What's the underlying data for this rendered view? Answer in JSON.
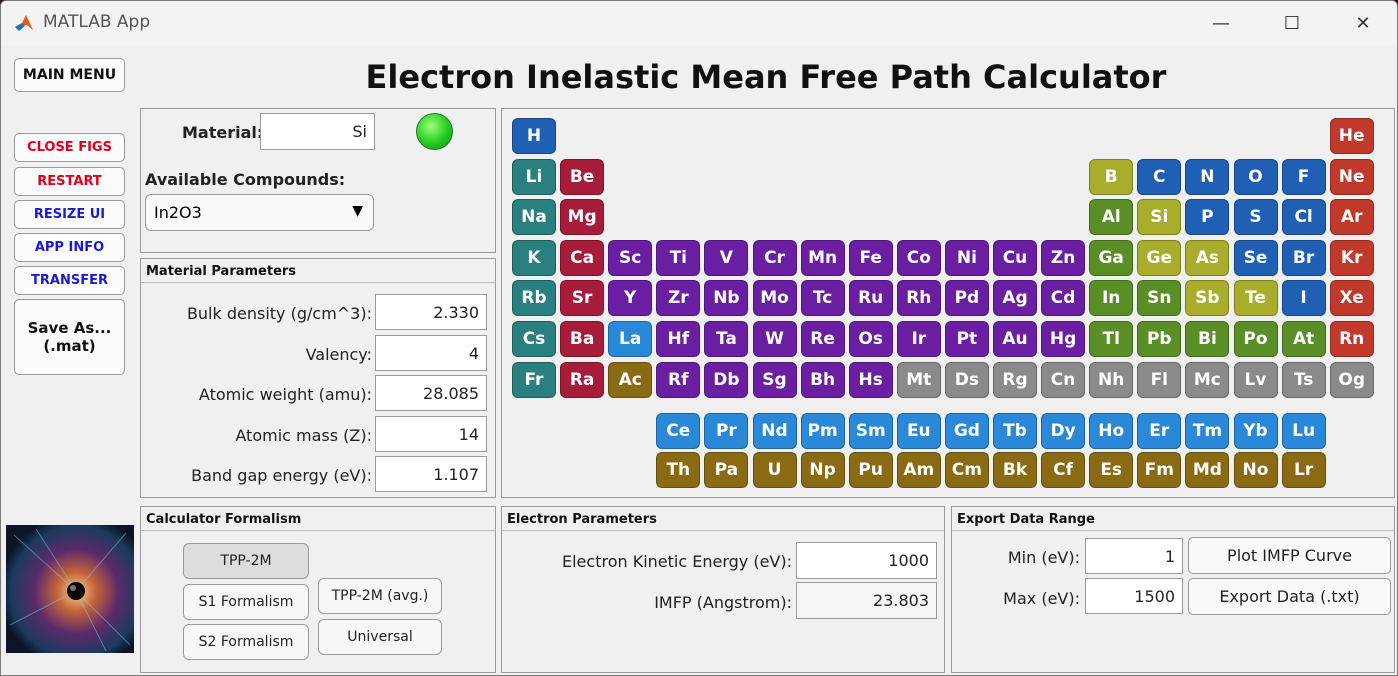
{
  "window": {
    "title": "MATLAB App"
  },
  "main_title": "Electron Inelastic Mean Free Path Calculator",
  "sidebar": {
    "main_menu": "MAIN MENU",
    "close_figs": "CLOSE FIGS",
    "restart": "RESTART",
    "resize_ui": "RESIZE UI",
    "app_info": "APP INFO",
    "transfer": "TRANSFER",
    "save_as_line1": "Save As...",
    "save_as_line2": "(.mat)"
  },
  "material": {
    "label": "Material:",
    "value": "Si",
    "status_color": "#22cc22",
    "compounds_label": "Available Compounds:",
    "compound_selected": "In2O3"
  },
  "material_params": {
    "heading": "Material Parameters",
    "rows": [
      {
        "label": "Bulk density (g/cm^3):",
        "value": "2.330"
      },
      {
        "label": "Valency:",
        "value": "4"
      },
      {
        "label": "Atomic weight (amu):",
        "value": "28.085"
      },
      {
        "label": "Atomic mass (Z):",
        "value": "14"
      },
      {
        "label": "Band gap energy (eV):",
        "value": "1.107"
      }
    ]
  },
  "calculator": {
    "heading": "Calculator Formalism",
    "tpp2m": "TPP-2M",
    "s1": "S1 Formalism",
    "s2": "S2 Formalism",
    "tpp2m_avg": "TPP-2M (avg.)",
    "universal": "Universal"
  },
  "electron_params": {
    "heading": "Electron Parameters",
    "ke_label": "Electron Kinetic Energy (eV):",
    "ke_value": "1000",
    "imfp_label": "IMFP (Angstrom):",
    "imfp_value": "23.803"
  },
  "export": {
    "heading": "Export Data Range",
    "min_label": "Min (eV):",
    "min_value": "1",
    "max_label": "Max (eV):",
    "max_value": "1500",
    "plot_btn": "Plot IMFP Curve",
    "export_btn": "Export Data (.txt)"
  },
  "colors": {
    "nonmetal": "#1f5fb4",
    "alkali": "#2a7f7f",
    "alkaline": "#a61c3a",
    "transition": "#6a1fa3",
    "post_transition": "#5a8f28",
    "metalloid": "#a9ad2c",
    "noble": "#c0392b",
    "unknown": "#8a8a8a",
    "lanthanide": "#2a88d8",
    "actinide": "#8a6a12"
  },
  "elements": [
    {
      "sym": "H",
      "c": "nonmetal",
      "r": 0,
      "col": 0
    },
    {
      "sym": "He",
      "c": "noble",
      "r": 0,
      "col": 17
    },
    {
      "sym": "Li",
      "c": "alkali",
      "r": 1,
      "col": 0
    },
    {
      "sym": "Be",
      "c": "alkaline",
      "r": 1,
      "col": 1
    },
    {
      "sym": "B",
      "c": "metalloid",
      "r": 1,
      "col": 12
    },
    {
      "sym": "C",
      "c": "nonmetal",
      "r": 1,
      "col": 13
    },
    {
      "sym": "N",
      "c": "nonmetal",
      "r": 1,
      "col": 14
    },
    {
      "sym": "O",
      "c": "nonmetal",
      "r": 1,
      "col": 15
    },
    {
      "sym": "F",
      "c": "nonmetal",
      "r": 1,
      "col": 16
    },
    {
      "sym": "Ne",
      "c": "noble",
      "r": 1,
      "col": 17
    },
    {
      "sym": "Na",
      "c": "alkali",
      "r": 2,
      "col": 0
    },
    {
      "sym": "Mg",
      "c": "alkaline",
      "r": 2,
      "col": 1
    },
    {
      "sym": "Al",
      "c": "post_transition",
      "r": 2,
      "col": 12
    },
    {
      "sym": "Si",
      "c": "metalloid",
      "r": 2,
      "col": 13
    },
    {
      "sym": "P",
      "c": "nonmetal",
      "r": 2,
      "col": 14
    },
    {
      "sym": "S",
      "c": "nonmetal",
      "r": 2,
      "col": 15
    },
    {
      "sym": "Cl",
      "c": "nonmetal",
      "r": 2,
      "col": 16
    },
    {
      "sym": "Ar",
      "c": "noble",
      "r": 2,
      "col": 17
    },
    {
      "sym": "K",
      "c": "alkali",
      "r": 3,
      "col": 0
    },
    {
      "sym": "Ca",
      "c": "alkaline",
      "r": 3,
      "col": 1
    },
    {
      "sym": "Sc",
      "c": "transition",
      "r": 3,
      "col": 2
    },
    {
      "sym": "Ti",
      "c": "transition",
      "r": 3,
      "col": 3
    },
    {
      "sym": "V",
      "c": "transition",
      "r": 3,
      "col": 4
    },
    {
      "sym": "Cr",
      "c": "transition",
      "r": 3,
      "col": 5
    },
    {
      "sym": "Mn",
      "c": "transition",
      "r": 3,
      "col": 6
    },
    {
      "sym": "Fe",
      "c": "transition",
      "r": 3,
      "col": 7
    },
    {
      "sym": "Co",
      "c": "transition",
      "r": 3,
      "col": 8
    },
    {
      "sym": "Ni",
      "c": "transition",
      "r": 3,
      "col": 9
    },
    {
      "sym": "Cu",
      "c": "transition",
      "r": 3,
      "col": 10
    },
    {
      "sym": "Zn",
      "c": "transition",
      "r": 3,
      "col": 11
    },
    {
      "sym": "Ga",
      "c": "post_transition",
      "r": 3,
      "col": 12
    },
    {
      "sym": "Ge",
      "c": "metalloid",
      "r": 3,
      "col": 13
    },
    {
      "sym": "As",
      "c": "metalloid",
      "r": 3,
      "col": 14
    },
    {
      "sym": "Se",
      "c": "nonmetal",
      "r": 3,
      "col": 15
    },
    {
      "sym": "Br",
      "c": "nonmetal",
      "r": 3,
      "col": 16
    },
    {
      "sym": "Kr",
      "c": "noble",
      "r": 3,
      "col": 17
    },
    {
      "sym": "Rb",
      "c": "alkali",
      "r": 4,
      "col": 0
    },
    {
      "sym": "Sr",
      "c": "alkaline",
      "r": 4,
      "col": 1
    },
    {
      "sym": "Y",
      "c": "transition",
      "r": 4,
      "col": 2
    },
    {
      "sym": "Zr",
      "c": "transition",
      "r": 4,
      "col": 3
    },
    {
      "sym": "Nb",
      "c": "transition",
      "r": 4,
      "col": 4
    },
    {
      "sym": "Mo",
      "c": "transition",
      "r": 4,
      "col": 5
    },
    {
      "sym": "Tc",
      "c": "transition",
      "r": 4,
      "col": 6
    },
    {
      "sym": "Ru",
      "c": "transition",
      "r": 4,
      "col": 7
    },
    {
      "sym": "Rh",
      "c": "transition",
      "r": 4,
      "col": 8
    },
    {
      "sym": "Pd",
      "c": "transition",
      "r": 4,
      "col": 9
    },
    {
      "sym": "Ag",
      "c": "transition",
      "r": 4,
      "col": 10
    },
    {
      "sym": "Cd",
      "c": "transition",
      "r": 4,
      "col": 11
    },
    {
      "sym": "In",
      "c": "post_transition",
      "r": 4,
      "col": 12
    },
    {
      "sym": "Sn",
      "c": "post_transition",
      "r": 4,
      "col": 13
    },
    {
      "sym": "Sb",
      "c": "metalloid",
      "r": 4,
      "col": 14
    },
    {
      "sym": "Te",
      "c": "metalloid",
      "r": 4,
      "col": 15
    },
    {
      "sym": "I",
      "c": "nonmetal",
      "r": 4,
      "col": 16
    },
    {
      "sym": "Xe",
      "c": "noble",
      "r": 4,
      "col": 17
    },
    {
      "sym": "Cs",
      "c": "alkali",
      "r": 5,
      "col": 0
    },
    {
      "sym": "Ba",
      "c": "alkaline",
      "r": 5,
      "col": 1
    },
    {
      "sym": "La",
      "c": "lanthanide",
      "r": 5,
      "col": 2
    },
    {
      "sym": "Hf",
      "c": "transition",
      "r": 5,
      "col": 3
    },
    {
      "sym": "Ta",
      "c": "transition",
      "r": 5,
      "col": 4
    },
    {
      "sym": "W",
      "c": "transition",
      "r": 5,
      "col": 5
    },
    {
      "sym": "Re",
      "c": "transition",
      "r": 5,
      "col": 6
    },
    {
      "sym": "Os",
      "c": "transition",
      "r": 5,
      "col": 7
    },
    {
      "sym": "Ir",
      "c": "transition",
      "r": 5,
      "col": 8
    },
    {
      "sym": "Pt",
      "c": "transition",
      "r": 5,
      "col": 9
    },
    {
      "sym": "Au",
      "c": "transition",
      "r": 5,
      "col": 10
    },
    {
      "sym": "Hg",
      "c": "transition",
      "r": 5,
      "col": 11
    },
    {
      "sym": "Tl",
      "c": "post_transition",
      "r": 5,
      "col": 12
    },
    {
      "sym": "Pb",
      "c": "post_transition",
      "r": 5,
      "col": 13
    },
    {
      "sym": "Bi",
      "c": "post_transition",
      "r": 5,
      "col": 14
    },
    {
      "sym": "Po",
      "c": "post_transition",
      "r": 5,
      "col": 15
    },
    {
      "sym": "At",
      "c": "post_transition",
      "r": 5,
      "col": 16
    },
    {
      "sym": "Rn",
      "c": "noble",
      "r": 5,
      "col": 17
    },
    {
      "sym": "Fr",
      "c": "alkali",
      "r": 6,
      "col": 0
    },
    {
      "sym": "Ra",
      "c": "alkaline",
      "r": 6,
      "col": 1
    },
    {
      "sym": "Ac",
      "c": "actinide",
      "r": 6,
      "col": 2
    },
    {
      "sym": "Rf",
      "c": "transition",
      "r": 6,
      "col": 3
    },
    {
      "sym": "Db",
      "c": "transition",
      "r": 6,
      "col": 4
    },
    {
      "sym": "Sg",
      "c": "transition",
      "r": 6,
      "col": 5
    },
    {
      "sym": "Bh",
      "c": "transition",
      "r": 6,
      "col": 6
    },
    {
      "sym": "Hs",
      "c": "transition",
      "r": 6,
      "col": 7
    },
    {
      "sym": "Mt",
      "c": "unknown",
      "r": 6,
      "col": 8
    },
    {
      "sym": "Ds",
      "c": "unknown",
      "r": 6,
      "col": 9
    },
    {
      "sym": "Rg",
      "c": "unknown",
      "r": 6,
      "col": 10
    },
    {
      "sym": "Cn",
      "c": "unknown",
      "r": 6,
      "col": 11
    },
    {
      "sym": "Nh",
      "c": "unknown",
      "r": 6,
      "col": 12
    },
    {
      "sym": "Fl",
      "c": "unknown",
      "r": 6,
      "col": 13
    },
    {
      "sym": "Mc",
      "c": "unknown",
      "r": 6,
      "col": 14
    },
    {
      "sym": "Lv",
      "c": "unknown",
      "r": 6,
      "col": 15
    },
    {
      "sym": "Ts",
      "c": "unknown",
      "r": 6,
      "col": 16
    },
    {
      "sym": "Og",
      "c": "unknown",
      "r": 6,
      "col": 17
    },
    {
      "sym": "Ce",
      "c": "lanthanide",
      "r": 7,
      "col": 3
    },
    {
      "sym": "Pr",
      "c": "lanthanide",
      "r": 7,
      "col": 4
    },
    {
      "sym": "Nd",
      "c": "lanthanide",
      "r": 7,
      "col": 5
    },
    {
      "sym": "Pm",
      "c": "lanthanide",
      "r": 7,
      "col": 6
    },
    {
      "sym": "Sm",
      "c": "lanthanide",
      "r": 7,
      "col": 7
    },
    {
      "sym": "Eu",
      "c": "lanthanide",
      "r": 7,
      "col": 8
    },
    {
      "sym": "Gd",
      "c": "lanthanide",
      "r": 7,
      "col": 9
    },
    {
      "sym": "Tb",
      "c": "lanthanide",
      "r": 7,
      "col": 10
    },
    {
      "sym": "Dy",
      "c": "lanthanide",
      "r": 7,
      "col": 11
    },
    {
      "sym": "Ho",
      "c": "lanthanide",
      "r": 7,
      "col": 12
    },
    {
      "sym": "Er",
      "c": "lanthanide",
      "r": 7,
      "col": 13
    },
    {
      "sym": "Tm",
      "c": "lanthanide",
      "r": 7,
      "col": 14
    },
    {
      "sym": "Yb",
      "c": "lanthanide",
      "r": 7,
      "col": 15
    },
    {
      "sym": "Lu",
      "c": "lanthanide",
      "r": 7,
      "col": 16
    },
    {
      "sym": "Th",
      "c": "actinide",
      "r": 8,
      "col": 3
    },
    {
      "sym": "Pa",
      "c": "actinide",
      "r": 8,
      "col": 4
    },
    {
      "sym": "U",
      "c": "actinide",
      "r": 8,
      "col": 5
    },
    {
      "sym": "Np",
      "c": "actinide",
      "r": 8,
      "col": 6
    },
    {
      "sym": "Pu",
      "c": "actinide",
      "r": 8,
      "col": 7
    },
    {
      "sym": "Am",
      "c": "actinide",
      "r": 8,
      "col": 8
    },
    {
      "sym": "Cm",
      "c": "actinide",
      "r": 8,
      "col": 9
    },
    {
      "sym": "Bk",
      "c": "actinide",
      "r": 8,
      "col": 10
    },
    {
      "sym": "Cf",
      "c": "actinide",
      "r": 8,
      "col": 11
    },
    {
      "sym": "Es",
      "c": "actinide",
      "r": 8,
      "col": 12
    },
    {
      "sym": "Fm",
      "c": "actinide",
      "r": 8,
      "col": 13
    },
    {
      "sym": "Md",
      "c": "actinide",
      "r": 8,
      "col": 14
    },
    {
      "sym": "No",
      "c": "actinide",
      "r": 8,
      "col": 15
    },
    {
      "sym": "Lr",
      "c": "actinide",
      "r": 8,
      "col": 16
    }
  ]
}
